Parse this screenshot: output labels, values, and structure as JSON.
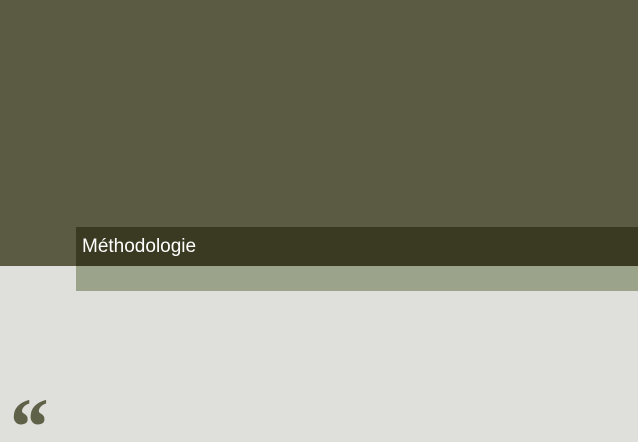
{
  "slide": {
    "title": "Méthodologie",
    "quote_glyph": "“"
  },
  "colors": {
    "top_panel": "#5A5B42",
    "title_bar": "#3A3A22",
    "accent_strip": "#9CA38B",
    "background": "#DFE0DB",
    "quote_mark": "#5F6148",
    "title_text": "#FFFFFF"
  }
}
